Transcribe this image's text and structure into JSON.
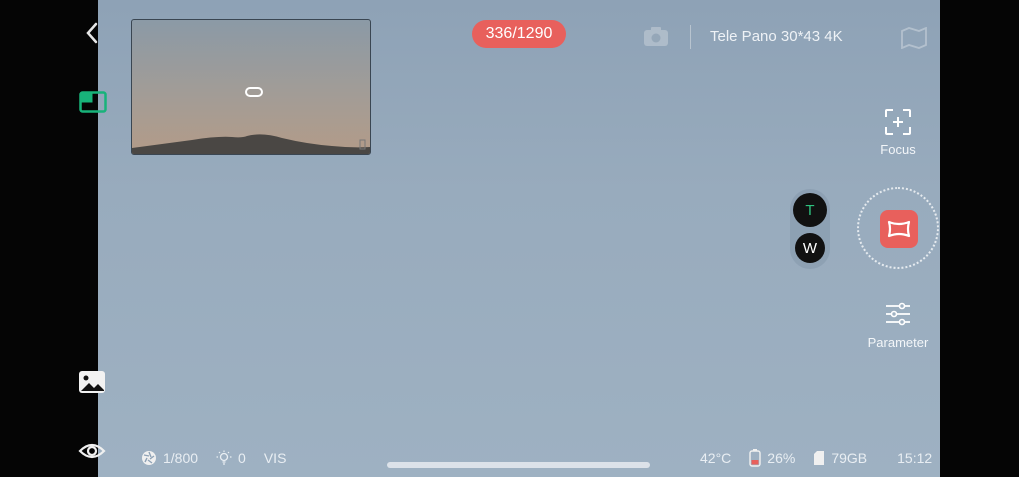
{
  "colors": {
    "accent": "#e8605c",
    "zoom_active": "#2ec27e",
    "battery_low": "#e8605c"
  },
  "top": {
    "counter": "336/1290",
    "mode": "Tele Pano 30*43 4K"
  },
  "right": {
    "focus_label": "Focus",
    "zoom_tele": "T",
    "zoom_wide": "W",
    "parameter_label": "Parameter"
  },
  "status": {
    "shutter": "1/800",
    "ev": "0",
    "channel": "VIS",
    "temperature": "42°C",
    "battery": "26%",
    "storage": "79GB",
    "time": "15:12"
  },
  "icons": [
    "back-icon",
    "layout-icon",
    "gallery-icon",
    "eye-icon",
    "camera-icon",
    "map-icon",
    "focus-icon",
    "panorama-icon",
    "sliders-icon",
    "aperture-icon",
    "exposure-icon",
    "battery-icon",
    "sd-card-icon"
  ]
}
